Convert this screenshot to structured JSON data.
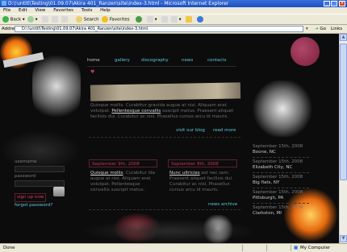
{
  "window": {
    "title": "D:\\!untitl\\Testing\\01.09.07\\Akira 401_Ranzen\\site\\index-3.html - Microsoft Internet Explorer"
  },
  "menu": [
    "File",
    "Edit",
    "View",
    "Favorites",
    "Tools",
    "Help"
  ],
  "toolbar": {
    "back": "Back",
    "search": "Search",
    "favorites": "Favorites"
  },
  "address": {
    "label": "Address",
    "value": "D:\\!untitl\\Testing\\01.09.07\\Akira 401_Ranzen\\site\\index-3.html",
    "go": "Go",
    "links": "Links"
  },
  "nav": [
    "home",
    "gallery",
    "discography",
    "news",
    "contacts"
  ],
  "intro": {
    "text_pre": "Quisque mollis. Curabitur gravida augue at nisi. Aliquam erat volutpat. ",
    "link": "Pellentesque convallis",
    "text_post": " suscipit metus. Praesent aliquet facilisis dui. Curabitur ac nisl. Phasellus cursus arcu id mauris."
  },
  "links": {
    "blog": "visit our blog",
    "read_more": "read more",
    "news_archive": "news archive"
  },
  "news": [
    {
      "date": "September 9th, 2008",
      "link": "Quisque mollis",
      "text": ". Curabitur ida augue at nisi. Aliquam erat volutpat. Pellentesque convallis suscipit metus."
    },
    {
      "date": "September 8th, 2008",
      "link": "Nunc ultricies",
      "text": " est nec sem. Praesent aliquet facilisis dui. Curabitur ac nisl. Phasellus cursus arcu id mauris."
    }
  ],
  "login": {
    "username": "username",
    "password": "password",
    "signup": "sign up now",
    "forgot": "forgot password?"
  },
  "events": [
    {
      "date": "September 15th, 2008",
      "place": "Boone, NC"
    },
    {
      "date": "September 15th, 2008",
      "place": "Elizabeth City, NC"
    },
    {
      "date": "September 15th, 2008",
      "place": "Big flats, NY"
    },
    {
      "date": "September 15th, 2008",
      "place": "Pittsburgh, PA"
    },
    {
      "date": "September 15th, 2008",
      "place": "Clarkston, MI"
    }
  ],
  "status": {
    "left": "Done",
    "zone": "My Computer"
  },
  "colors": {
    "accent_cyan": "#5ac8d8",
    "accent_red": "#c8344e",
    "page_bg": "#0c0c0c"
  }
}
